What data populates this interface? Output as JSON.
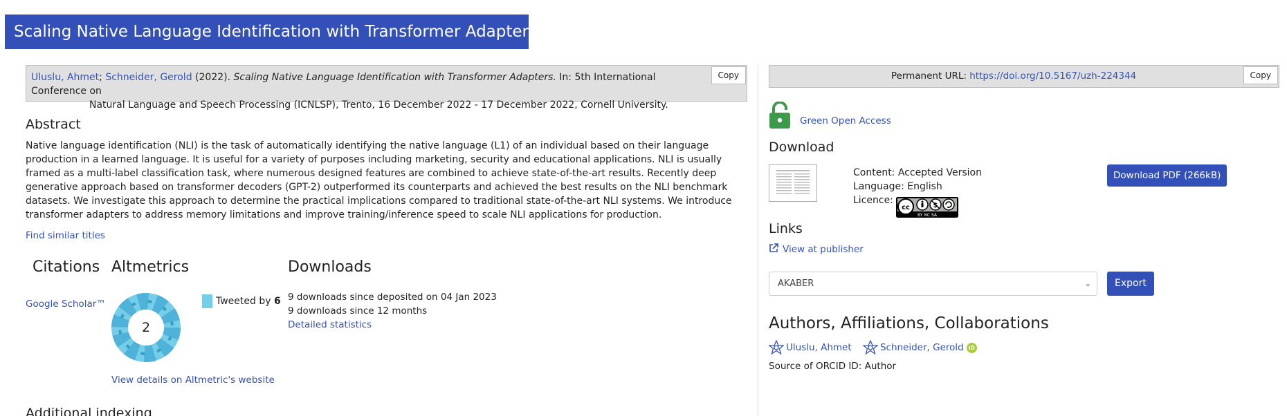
{
  "page": {
    "title": "Scaling Native Language Identification with Transformer Adapters"
  },
  "citation": {
    "author1": "Uluslu, Ahmet",
    "sep": ";",
    "author2": "Schneider, Gerold",
    "year": "(2022).",
    "title_italic": "Scaling Native Language Identification with Transformer Adapters.",
    "venue_line1": "In: 5th International Conference on",
    "venue_line2": "Natural Language and Speech Processing (ICNLSP), Trento, 16 December 2022 - 17 December 2022, Cornell University.",
    "copy_label": "Copy"
  },
  "abstract": {
    "heading": "Abstract",
    "text": "Native language identification (NLI) is the task of automatically identifying the native language (L1) of an individual based on their language production in a learned language. It is useful for a variety of purposes including marketing, security and educational applications. NLI is usually framed as a multi-label classification task, where numerous designed features are combined to achieve state-of-the-art results. Recently deep generative approach based on transformer decoders (GPT-2) outperformed its counterparts and achieved the best results on the NLI benchmark datasets. We investigate this approach to determine the practical implications compared to traditional state-of-the-art NLI systems. We introduce transformer adapters to address memory limitations and improve training/inference speed to scale NLI applications for production.",
    "similar_link": "Find similar titles"
  },
  "citations": {
    "heading": "Citations",
    "google_scholar": "Google Scholar™"
  },
  "altmetrics": {
    "heading": "Altmetrics",
    "score": "2",
    "tweeted_prefix": "Tweeted by",
    "tweeted_count": "6",
    "details_link": "View details on Altmetric's website"
  },
  "downloads": {
    "heading": "Downloads",
    "line1": "9 downloads since deposited on 04 Jan 2023",
    "line2": "9 downloads since 12 months",
    "stats_link": "Detailed statistics"
  },
  "additional_indexing": {
    "heading": "Additional indexing"
  },
  "permanent": {
    "label": "Permanent URL:",
    "url": "https://doi.org/10.5167/uzh-224344",
    "copy_label": "Copy"
  },
  "open_access": {
    "label": "Green Open Access",
    "color": "#3c9a4a"
  },
  "download": {
    "heading": "Download",
    "content": "Content: Accepted Version",
    "language": "Language: English",
    "licence": "Licence:",
    "licence_badge": "BY NC SA",
    "button": "Download PDF (266kB)"
  },
  "links": {
    "heading": "Links",
    "publisher": "View at publisher"
  },
  "export": {
    "selected": "AKABER",
    "button": "Export"
  },
  "authors": {
    "heading": "Authors, Affiliations, Collaborations",
    "list": [
      "Uluslu, Ahmet",
      "Schneider, Gerold"
    ],
    "orcid_badge": "iD",
    "orcid_source": "Source of ORCID ID: Author"
  },
  "colors": {
    "accent": "#3250b8",
    "link": "#3453b5",
    "altmetric": "#74cee8"
  }
}
